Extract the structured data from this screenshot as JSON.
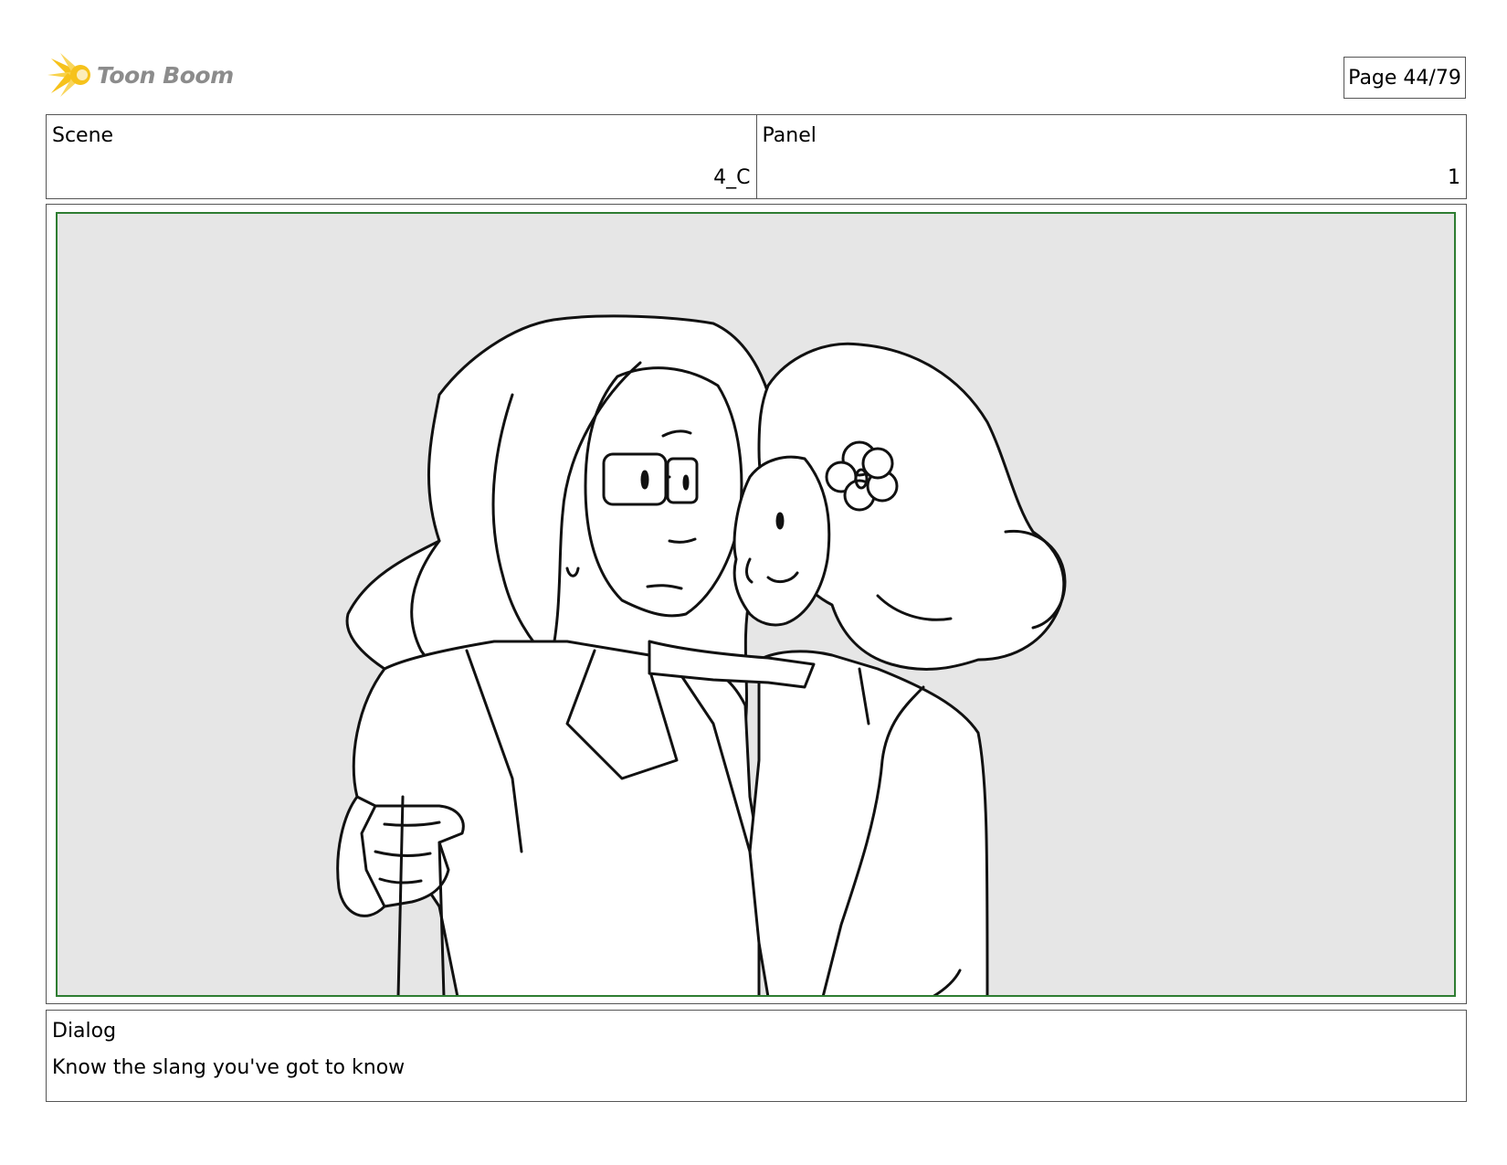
{
  "header": {
    "logo_text": "Toon Boom",
    "page_label": "Page 44/79"
  },
  "info": {
    "scene_label": "Scene",
    "scene_value": "4_C",
    "panel_label": "Panel",
    "panel_value": "1"
  },
  "frame": {
    "background_color": "#e6e6e6",
    "safe_area_color": "#2e7d32"
  },
  "dialog": {
    "label": "Dialog",
    "text": "Know the slang you've got to know"
  },
  "colors": {
    "logo_yellow": "#f6c21b",
    "logo_text_gray": "#8c8c8c"
  }
}
